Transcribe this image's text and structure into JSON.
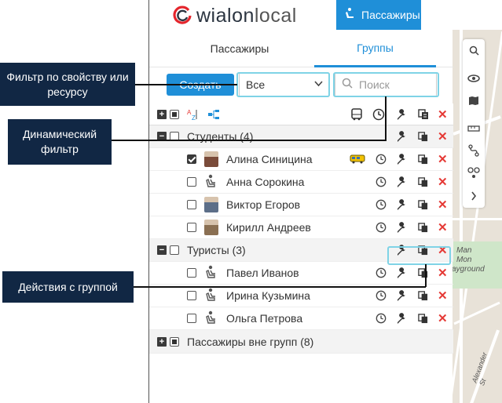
{
  "brand": {
    "logo_main": "wialon",
    "logo_second": "local",
    "app_tab": "Пассажиры"
  },
  "tabs": [
    {
      "label": "Пассажиры"
    },
    {
      "label": "Группы"
    }
  ],
  "controls": {
    "create_label": "Создать",
    "filter_value": "Все",
    "search_placeholder": "Поиск"
  },
  "groups": [
    {
      "name": "Студенты (4)",
      "members": [
        {
          "name": "Алина Синицина",
          "checked": true,
          "avatar": "photo",
          "bus": true
        },
        {
          "name": "Анна Сорокина",
          "checked": false,
          "avatar": "passenger-icon",
          "bus": false
        },
        {
          "name": "Виктор Егоров",
          "checked": false,
          "avatar": "photo",
          "bus": false
        },
        {
          "name": "Кирилл Андреев",
          "checked": false,
          "avatar": "photo",
          "bus": false
        }
      ]
    },
    {
      "name": "Туристы (3)",
      "members": [
        {
          "name": "Павел Иванов",
          "checked": false,
          "avatar": "passenger-icon",
          "bus": false
        },
        {
          "name": "Ирина Кузьмина",
          "checked": false,
          "avatar": "passenger-icon",
          "bus": false
        },
        {
          "name": "Ольга Петрова",
          "checked": false,
          "avatar": "passenger-icon",
          "bus": false
        }
      ]
    },
    {
      "name": "Пассажиры вне групп (8)",
      "members": []
    }
  ],
  "callouts": {
    "filter": "Фильтр по свойству или ресурсу",
    "dynamic": "Динамический фильтр",
    "group_actions": "Действия с группой"
  },
  "map_labels": {
    "label1": "Man",
    "label2": "Mon",
    "label3": "ayground",
    "label4": "Alexander St"
  },
  "colors": {
    "accent": "#1f8fd8",
    "delete": "#e53935",
    "callout_bg": "#112744",
    "highlight": "#7fd3e6"
  }
}
